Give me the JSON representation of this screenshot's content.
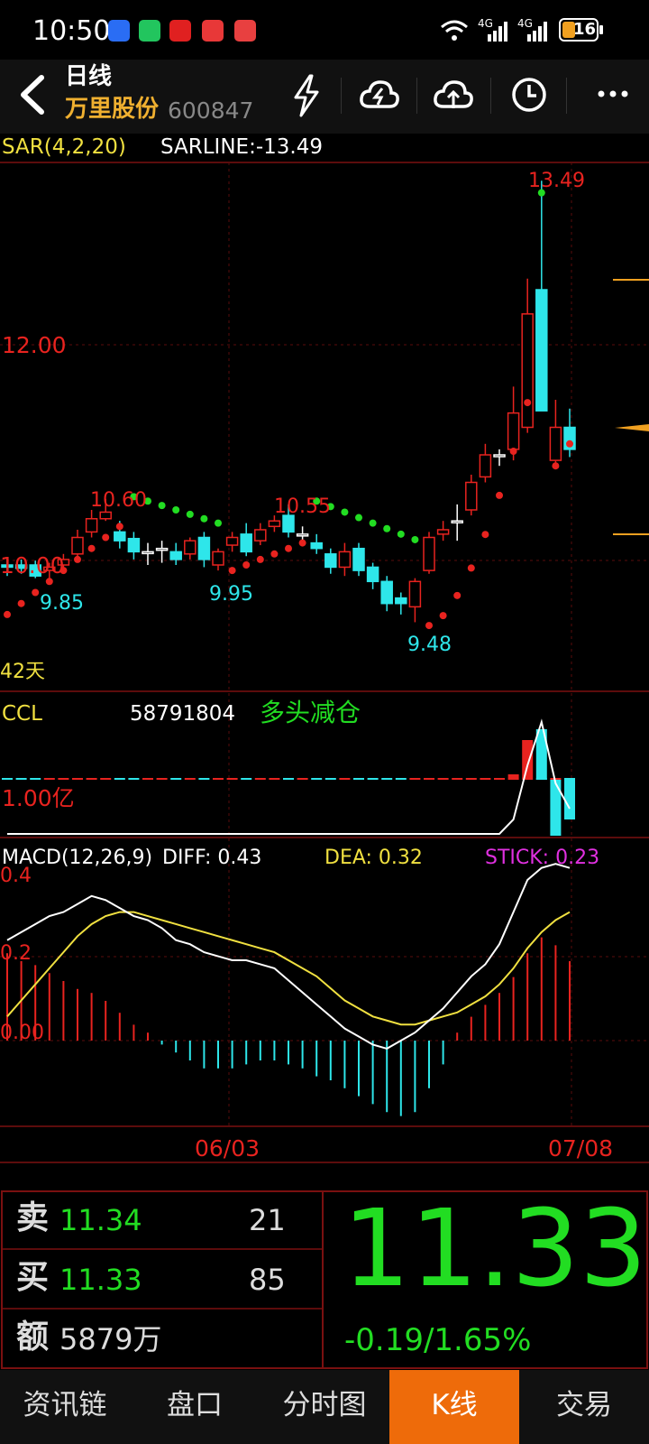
{
  "status_bar": {
    "time": "10:50",
    "battery": "16",
    "net1": "4G",
    "net2": "4G"
  },
  "header": {
    "period": "日线",
    "stock_name": "万里股份",
    "stock_code": "600847"
  },
  "sar_panel": {
    "title": "SAR(4,2,20)",
    "value": "SARLINE:-13.49",
    "price_12": "12.00",
    "price_10": "10.00",
    "label_10_60": "10.60",
    "label_10_55": "10.55",
    "label_9_85": "9.85",
    "label_9_95": "9.95",
    "label_9_48": "9.48",
    "label_13_49": "13.49",
    "days": "42天"
  },
  "ccl_panel": {
    "title": "CCL",
    "value": "58791804",
    "signal": "多头减仓",
    "axis": "1.00亿"
  },
  "macd_panel": {
    "title": "MACD(12,26,9)",
    "diff": "DIFF: 0.43",
    "dea": "DEA: 0.32",
    "stick": "STICK: 0.23",
    "ax_04": "0.4",
    "ax_02": "0.2",
    "ax_00": "0.00"
  },
  "dates": {
    "d1": "06/03",
    "d2": "07/08"
  },
  "quote": {
    "sell_label": "卖",
    "sell_price": "11.34",
    "sell_vol": "21",
    "buy_label": "买",
    "buy_price": "11.33",
    "buy_vol": "85",
    "amount_label": "额",
    "amount": "5879万",
    "last_price": "11.33",
    "change": "-0.19/1.65%"
  },
  "tabs": [
    "资讯链",
    "盘口",
    "分时图",
    "K线",
    "交易"
  ],
  "colors": {
    "up": "#e8231f",
    "down": "#2ee6ea",
    "green": "#22dd22",
    "accent": "#ee6b0a",
    "yellow": "#f0e040"
  }
}
